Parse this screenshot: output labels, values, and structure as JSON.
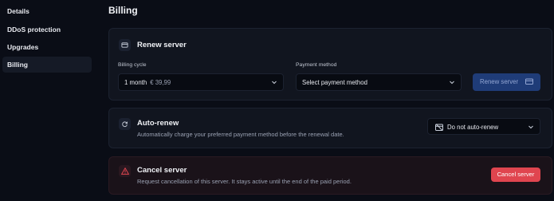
{
  "sidebar": {
    "items": [
      {
        "label": "Details"
      },
      {
        "label": "DDoS protection"
      },
      {
        "label": "Upgrades"
      },
      {
        "label": "Billing"
      }
    ]
  },
  "page": {
    "title": "Billing"
  },
  "renew": {
    "title": "Renew server",
    "billing_cycle_label": "Billing cycle",
    "billing_cycle_value": "1 month",
    "billing_cycle_price": "€ 39,99",
    "payment_method_label": "Payment method",
    "payment_method_value": "Select payment method",
    "button_label": "Renew server"
  },
  "autorenew": {
    "title": "Auto-renew",
    "description": "Automatically charge your preferred payment method before the renewal date.",
    "select_value": "Do not auto-renew"
  },
  "cancel": {
    "title": "Cancel server",
    "description": "Request cancellation of this server. It stays active until the end of the paid period.",
    "button_label": "Cancel server"
  },
  "colors": {
    "background": "#0a0d16",
    "card": "#11151f",
    "primary_button": "#1f3c78",
    "danger_button": "#e0454f"
  }
}
